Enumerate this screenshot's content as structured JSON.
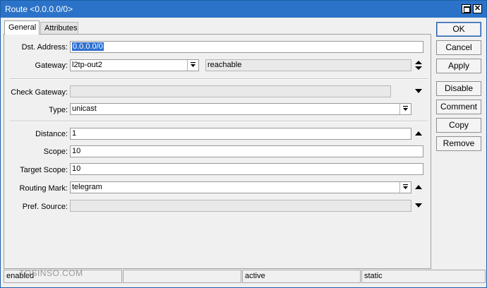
{
  "window": {
    "title": "Route <0.0.0.0/0>"
  },
  "tabs": [
    {
      "label": "General"
    },
    {
      "label": "Attributes"
    }
  ],
  "form": {
    "dst_address": {
      "label": "Dst. Address:",
      "value": "0.0.0.0/0"
    },
    "gateway": {
      "label": "Gateway:",
      "value": "l2tp-out2",
      "state": "reachable"
    },
    "check_gateway": {
      "label": "Check Gateway:",
      "value": ""
    },
    "type": {
      "label": "Type:",
      "value": "unicast"
    },
    "distance": {
      "label": "Distance:",
      "value": "1"
    },
    "scope": {
      "label": "Scope:",
      "value": "10"
    },
    "target_scope": {
      "label": "Target Scope:",
      "value": "10"
    },
    "routing_mark": {
      "label": "Routing Mark:",
      "value": "telegram"
    },
    "pref_source": {
      "label": "Pref. Source:",
      "value": ""
    }
  },
  "buttons": {
    "ok": "OK",
    "cancel": "Cancel",
    "apply": "Apply",
    "disable": "Disable",
    "comment": "Comment",
    "copy": "Copy",
    "remove": "Remove"
  },
  "status_bar": {
    "state": "enabled",
    "middle": "",
    "active": "active",
    "static": "static"
  },
  "watermark": "TOSINSO.COM",
  "icons": {
    "close": "close-icon",
    "maximize": "maximize-icon",
    "dropdown": "dropdown-arrow-icon",
    "up": "triangle-up-icon",
    "down": "triangle-down-icon",
    "updown": "up-down-icon"
  }
}
